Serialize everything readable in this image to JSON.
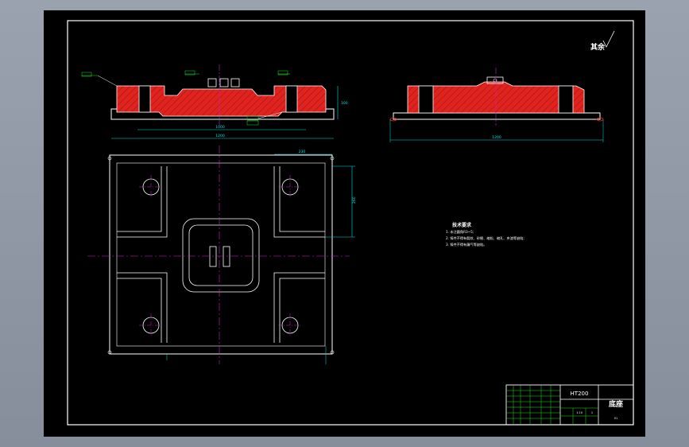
{
  "colors": {
    "background": "#000000",
    "frame": "#ffffff",
    "hatch": "#e0231e",
    "centerline": "#d020d0",
    "dimension": "#00e0e0",
    "leader_green": "#20e020",
    "text": "#ffffff"
  },
  "surface_finish_note": "其余",
  "material": "HT200",
  "part_name": "底座",
  "tech_requirements": {
    "title": "技术要求",
    "items": [
      "1. 未注圆角R3~5;",
      "2. 铸件不得有裂纹、砂眼、缩松、缩孔、夹渣等缺陷;",
      "3. 铸件不得有漏气等缺陷。"
    ]
  },
  "dimensions": {
    "front_inner_length": "1000",
    "front_overall_length": "1200",
    "front_height": "100",
    "side_overall_length": "1200",
    "plan_top_width": "230",
    "plan_right_height": "260"
  },
  "title_block": {
    "scale": "1:10",
    "sheet": "1",
    "drawing_no": "01"
  }
}
